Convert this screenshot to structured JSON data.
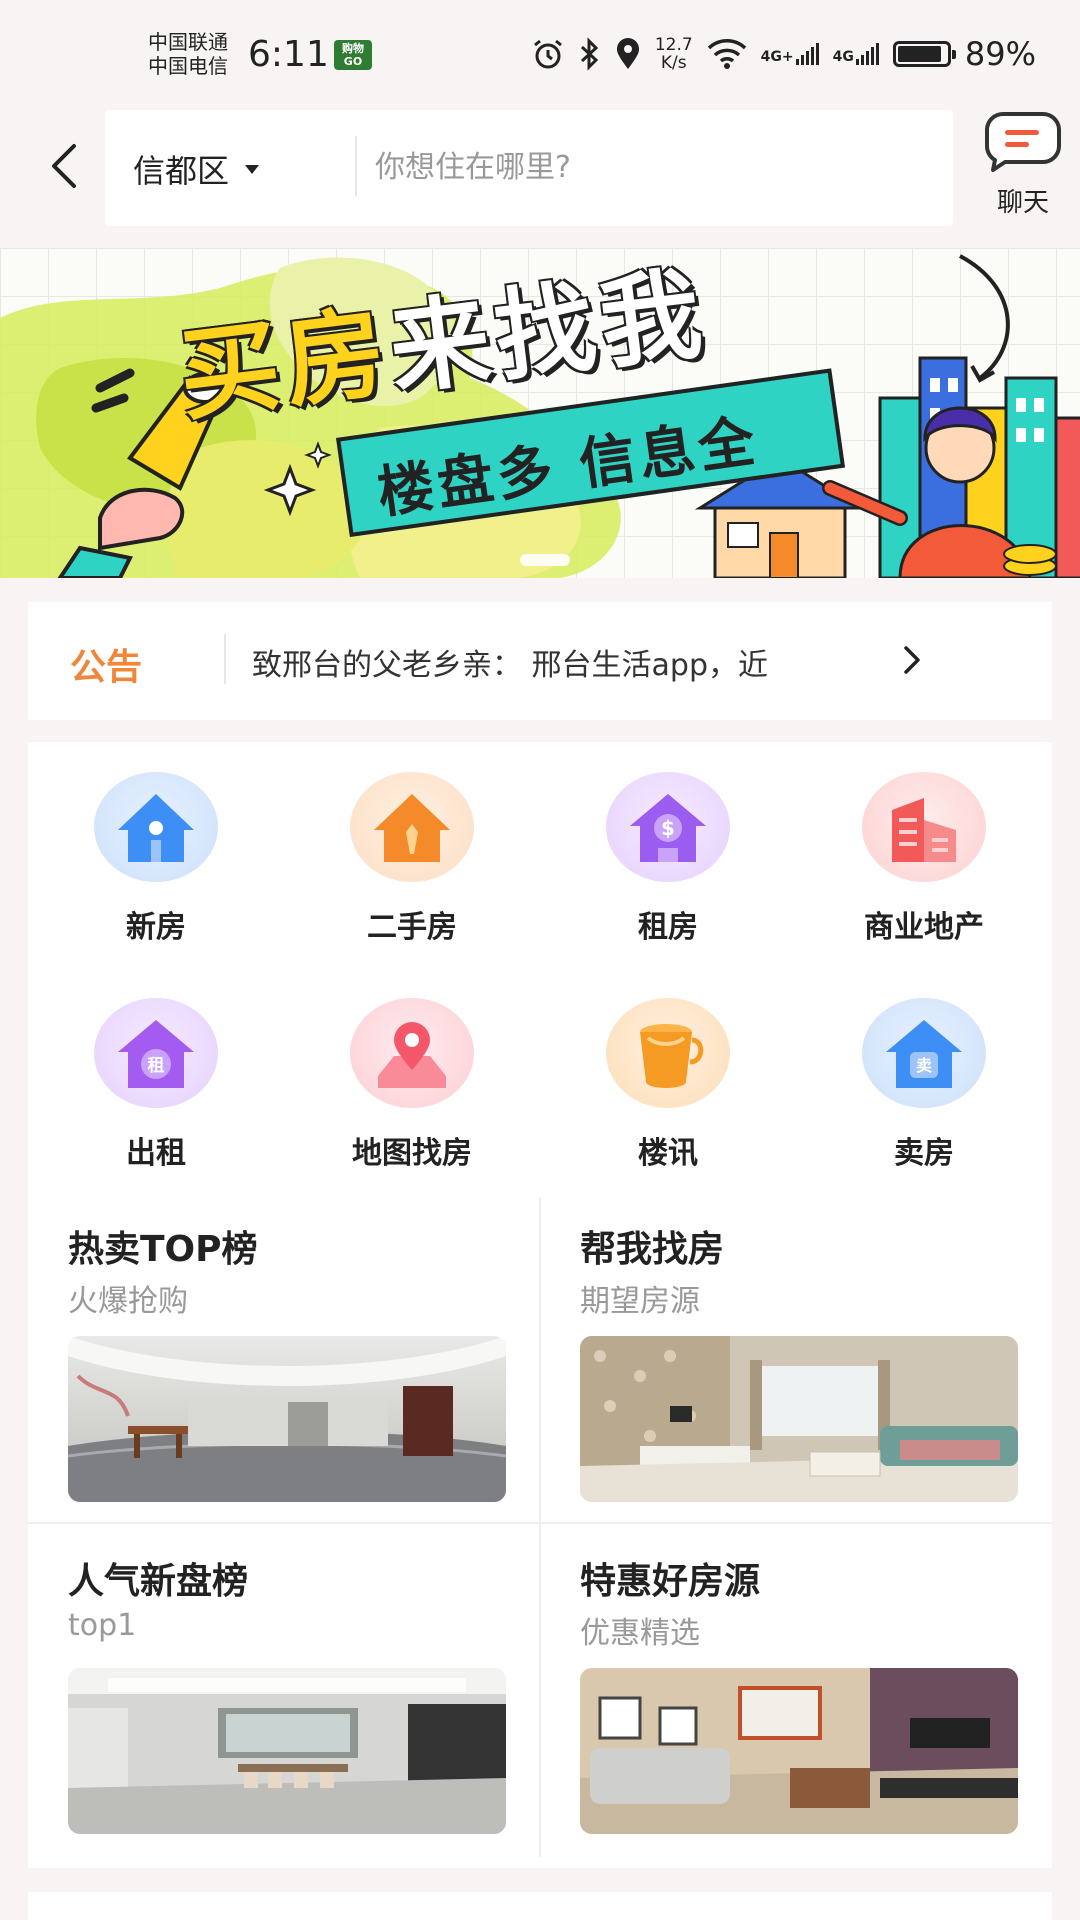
{
  "status_bar": {
    "carrier_1": "中国联通",
    "carrier_2": "中国电信",
    "time": "6:11",
    "app_badge": "购物GO",
    "speed_value": "12.7",
    "speed_unit": "K/s",
    "net_1": "4G+",
    "net_2": "4G",
    "battery_level": 0.89,
    "battery_text": "89%"
  },
  "header": {
    "district": "信都区",
    "search_placeholder": "你想住在哪里?",
    "chat_label": "聊天"
  },
  "banner": {
    "title_part_1": "买房",
    "title_part_2": "来找我",
    "subtitle": "楼盘多 信息全"
  },
  "notice": {
    "label": "公告",
    "text": "致邢台的父老乡亲：  邢台生活app，近"
  },
  "categories": [
    {
      "label": "新房",
      "icon": "house-icon",
      "color": "#3d8ef5"
    },
    {
      "label": "二手房",
      "icon": "tie-house-icon",
      "color": "#f58a2a"
    },
    {
      "label": "租房",
      "icon": "dollar-house-icon",
      "color": "#9b5cf0"
    },
    {
      "label": "商业地产",
      "icon": "buildings-icon",
      "color": "#f25a5a"
    },
    {
      "label": "出租",
      "icon": "rent-house-icon",
      "color": "#a45cf0"
    },
    {
      "label": "地图找房",
      "icon": "map-pin-icon",
      "color": "#f5576a"
    },
    {
      "label": "楼讯",
      "icon": "paint-bucket-icon",
      "color": "#f59a22"
    },
    {
      "label": "卖房",
      "icon": "sell-house-icon",
      "color": "#3d8ef5"
    }
  ],
  "features": [
    {
      "title": "热卖TOP榜",
      "subtitle": "火爆抢购"
    },
    {
      "title": "帮我找房",
      "subtitle": "期望房源"
    },
    {
      "title": "人气新盘榜",
      "subtitle": "top1"
    },
    {
      "title": "特惠好房源",
      "subtitle": "优惠精选"
    }
  ],
  "colors": {
    "accent": "#f0863a",
    "background": "#f7f4f3"
  }
}
